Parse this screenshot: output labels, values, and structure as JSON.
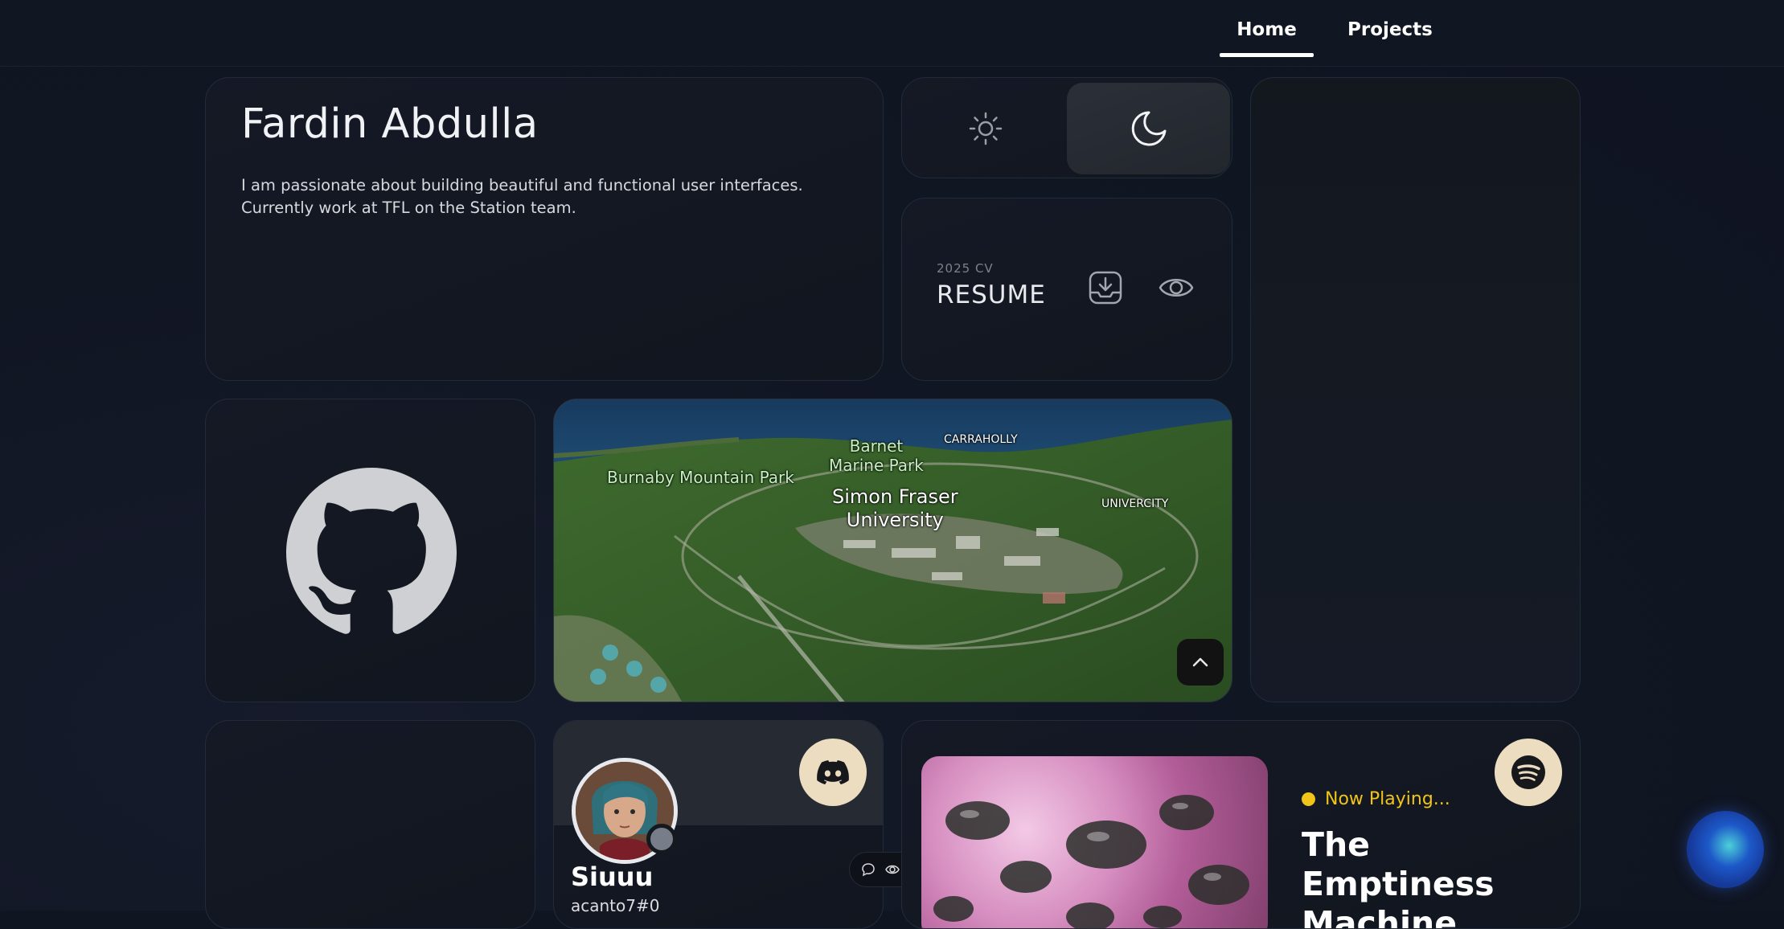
{
  "nav": {
    "home": "Home",
    "projects": "Projects"
  },
  "intro": {
    "name": "Fardin Abdulla",
    "bio_line1": "I am passionate about building beautiful and functional user interfaces.",
    "bio_line2": "Currently work at TFL on the Station team."
  },
  "theme": {
    "active": "dark",
    "light_icon": "sun-icon",
    "dark_icon": "moon-icon"
  },
  "resume": {
    "subtitle": "2025 CV",
    "title": "RESUME",
    "download_icon": "download-icon",
    "view_icon": "eye-icon"
  },
  "github": {
    "icon": "github-icon"
  },
  "map": {
    "labels": {
      "barnet": "Barnet\nMarine Park",
      "carraholly": "CARRAHOLLY",
      "burnaby": "Burnaby Mountain Park",
      "sfu": "Simon Fraser\nUniversity",
      "univercity": "UNIVERCITY"
    },
    "scroll_icon": "chevron-up-icon"
  },
  "discord": {
    "username": "Siuuu",
    "tag": "acanto7#0",
    "icon": "discord-icon",
    "status_color": "#777e8a"
  },
  "spotify": {
    "status": "Now Playing...",
    "track": "The Emptiness Machine",
    "icon": "spotify-icon"
  },
  "colors": {
    "accent_yellow": "#f0c419",
    "badge": "#ecdcc0",
    "background": "#111623"
  }
}
